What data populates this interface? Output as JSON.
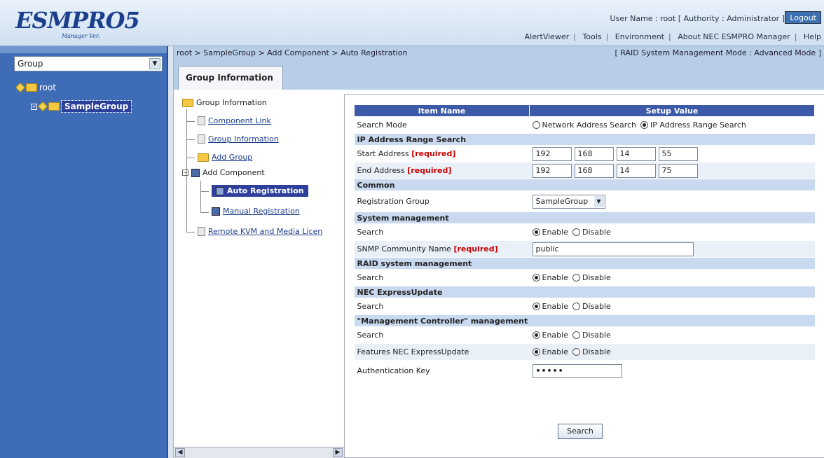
{
  "header": {
    "logo": "ESMPRO5",
    "logo_sub": "Manager Ver.",
    "user_info": "User Name : root [ Authority : Administrator ]",
    "logout": "Logout",
    "nav": [
      "AlertViewer",
      "Tools",
      "Environment",
      "About NEC ESMPRO Manager",
      "Help"
    ]
  },
  "sidebar": {
    "group_select": "Group",
    "root": "root",
    "selected_group": "SampleGroup"
  },
  "breadcrumb": "root > SampleGroup > Add Component > Auto Registration",
  "mode": "[ RAID System Management Mode : Advanced Mode ]",
  "tab": "Group Information",
  "tree": {
    "root": "Group Information",
    "component_link": "Component Link",
    "group_information": "Group Information",
    "add_group": "Add Group",
    "add_component": "Add Component",
    "auto_registration": "Auto Registration",
    "manual_registration": "Manual Registration",
    "remote_kvm": "Remote KVM and Media Licen"
  },
  "form": {
    "col_item": "Item Name",
    "col_value": "Setup Value",
    "search_mode": "Search Mode",
    "opt_network": "Network Address Search",
    "opt_iprange": "IP Address Range Search",
    "sec_iprange": "IP Address Range Search",
    "start_address": "Start Address",
    "end_address": "End Address",
    "required": "[required]",
    "start_ip": [
      "192",
      "168",
      "14",
      "55"
    ],
    "end_ip": [
      "192",
      "168",
      "14",
      "75"
    ],
    "sec_common": "Common",
    "registration_group": "Registration Group",
    "registration_group_value": "SampleGroup",
    "sec_system": "System management",
    "search": "Search",
    "enable": "Enable",
    "disable": "Disable",
    "snmp": "SNMP Community Name",
    "snmp_value": "public",
    "sec_raid": "RAID system management",
    "sec_express": "NEC ExpressUpdate",
    "sec_mc": "\"Management Controller\" management",
    "features_express": "Features NEC ExpressUpdate",
    "auth_key": "Authentication Key",
    "auth_value": "•••••",
    "search_button": "Search"
  }
}
